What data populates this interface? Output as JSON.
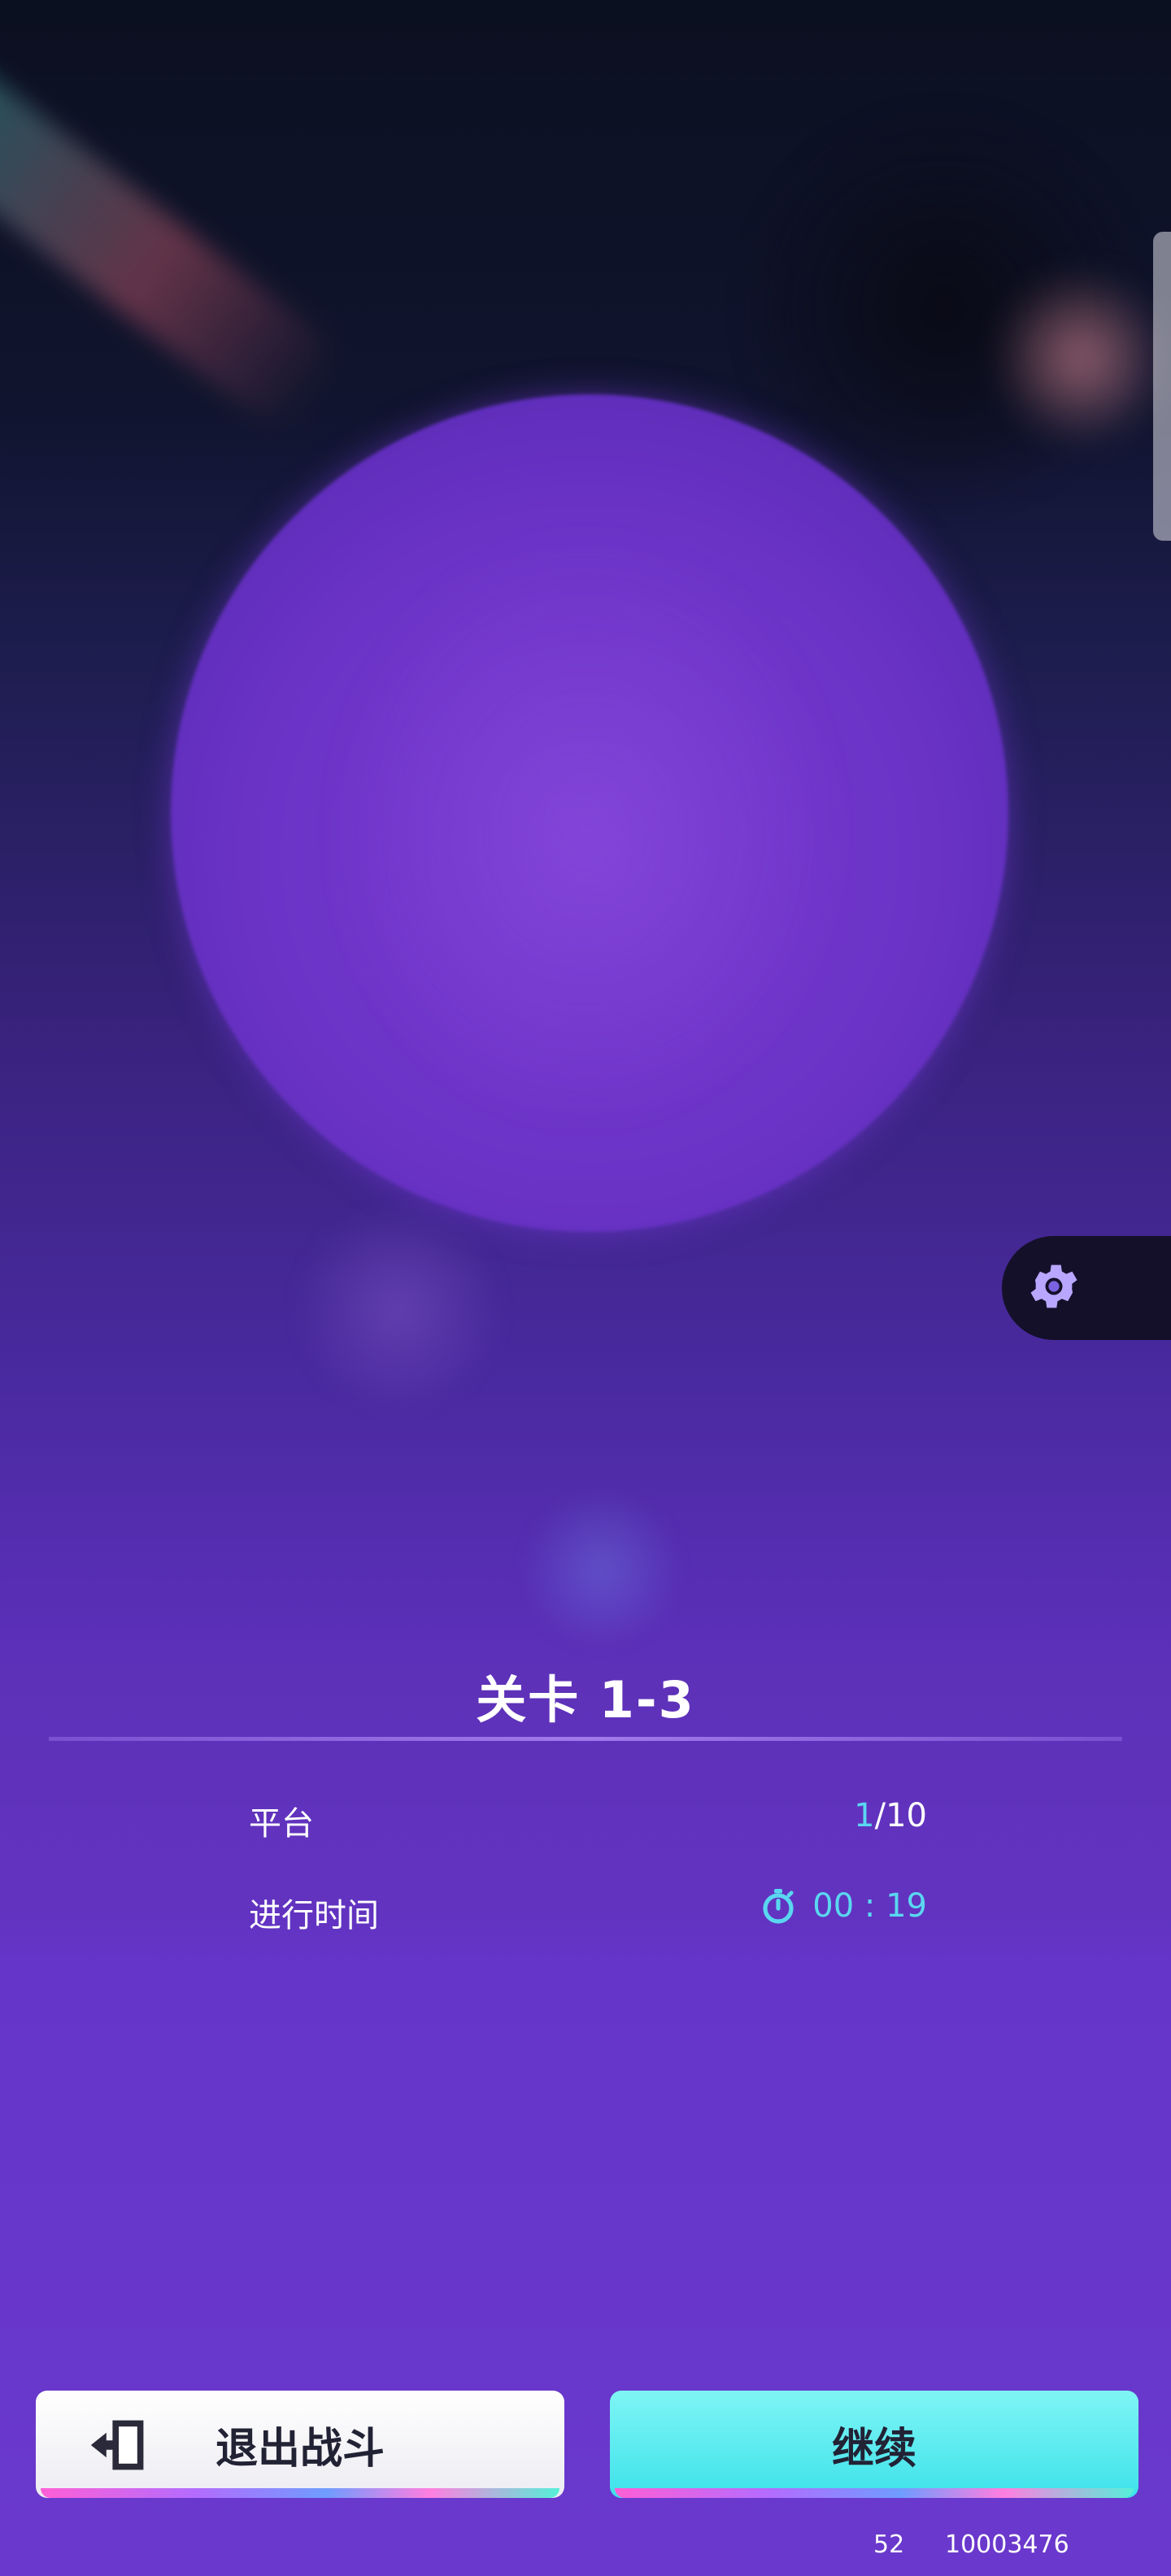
{
  "level": {
    "title": "关卡 1-3"
  },
  "stats": [
    {
      "label": "平台",
      "value_current": "1",
      "value_total": "/10"
    },
    {
      "label": "进行时间",
      "value": "00 : 19"
    }
  ],
  "buttons": {
    "exit_label": "退出战斗",
    "continue_label": "继续"
  },
  "footer": {
    "left": "52",
    "right": "10003476"
  },
  "icons": {
    "settings": "gear-icon",
    "timer": "stopwatch-icon",
    "exit": "exit-door-icon"
  },
  "colors": {
    "accent": "#5ad7f0",
    "continue_bg": "#3ee2ea",
    "panel_bg": "#6434c8"
  }
}
